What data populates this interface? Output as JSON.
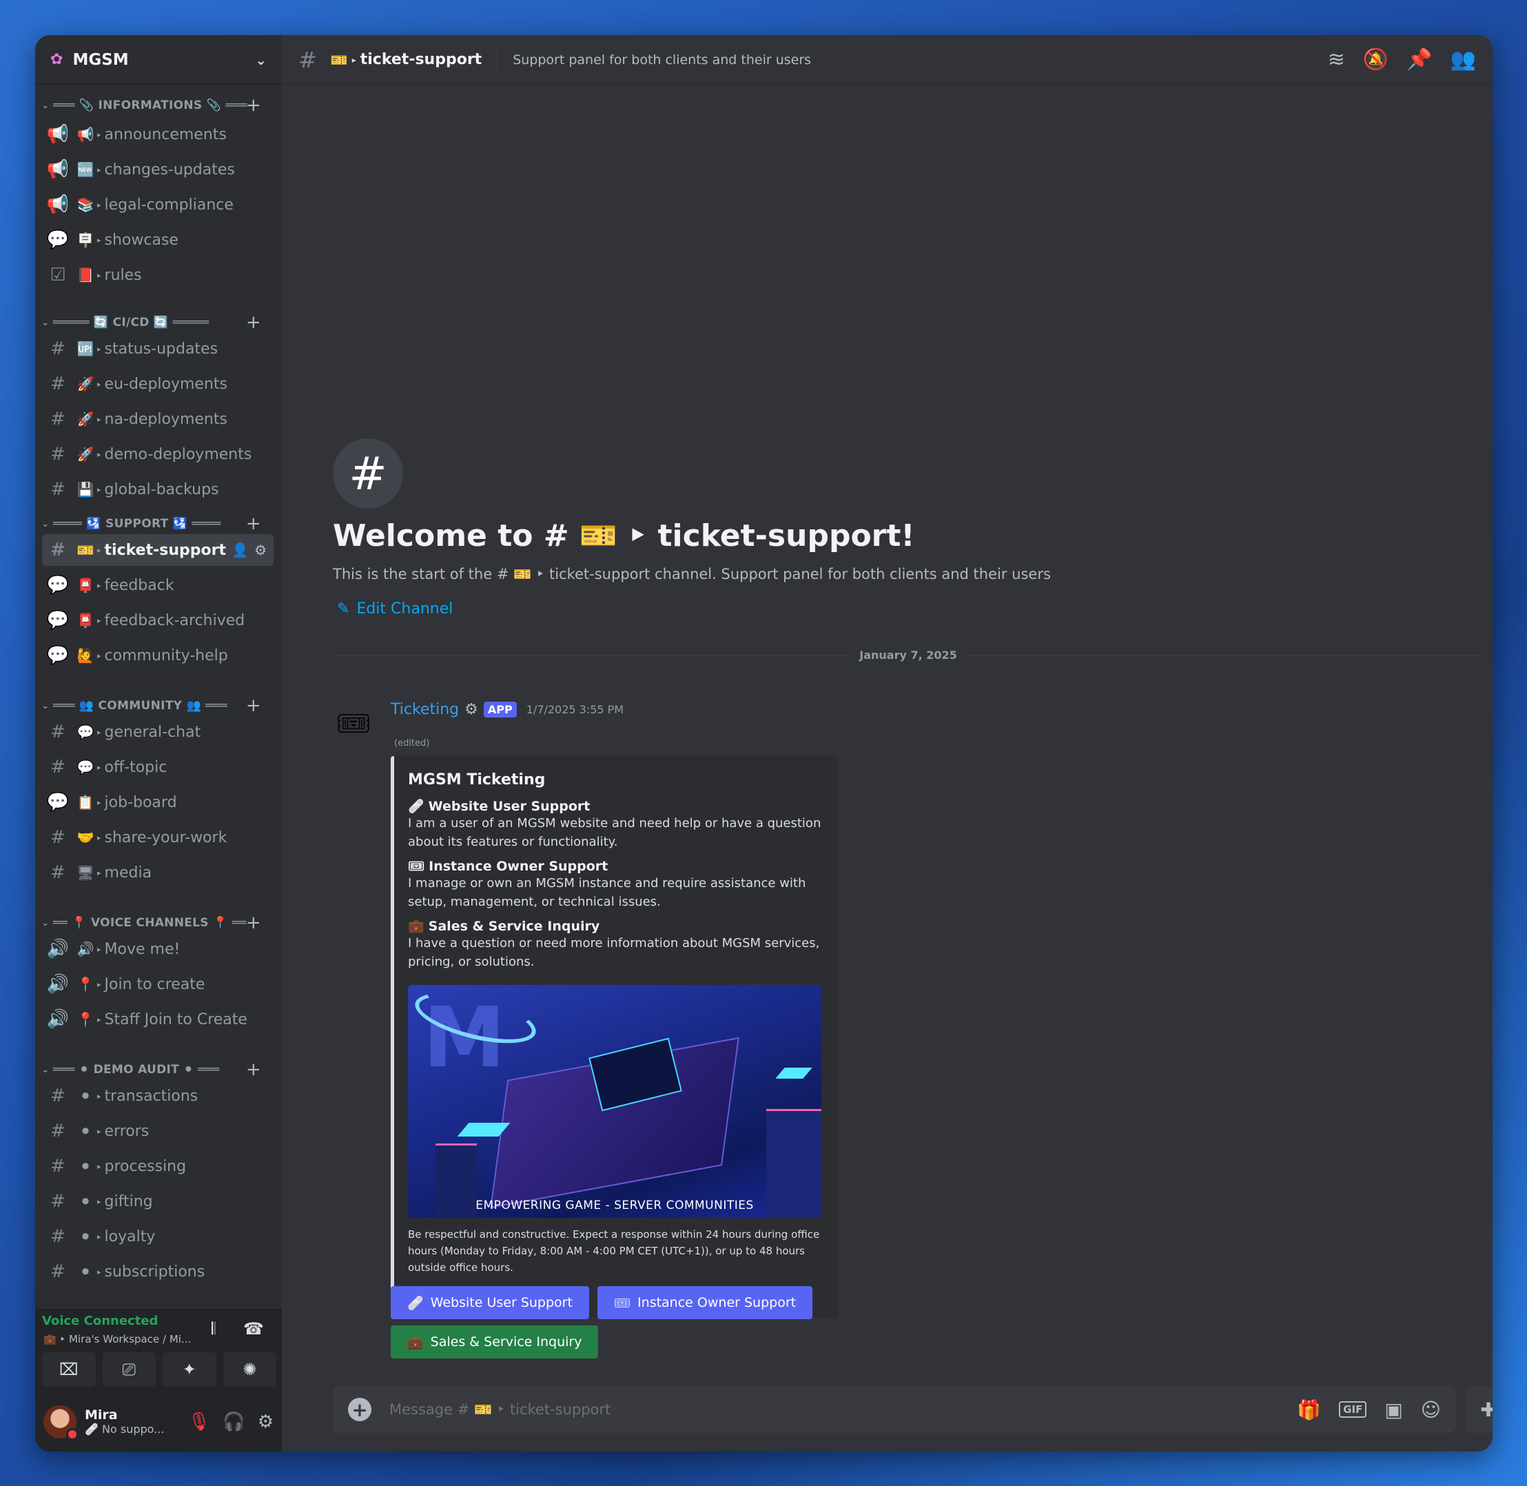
{
  "server": {
    "name": "MGSM"
  },
  "categories": {
    "informations": {
      "label": "═══ 📎 INFORMATIONS 📎 ═══"
    },
    "cicd": {
      "label": "═════ 🔄 CI/CD 🔄 ═════"
    },
    "support": {
      "label": "════ 🛂 SUPPORT 🛂 ════"
    },
    "community": {
      "label": "═══ 👥 COMMUNITY 👥 ═══"
    },
    "voice": {
      "label": "══ 📍 VOICE CHANNELS 📍 ══"
    },
    "demo_audit": {
      "label": "═══ ⚫ DEMO AUDIT ⚫ ═══"
    }
  },
  "channels": [
    {
      "type": "📢",
      "emoji": "📢",
      "label": "announcements"
    },
    {
      "type": "📢",
      "emoji": "🆕",
      "label": "changes-updates"
    },
    {
      "type": "📢",
      "emoji": "📚",
      "label": "legal-compliance"
    },
    {
      "type": "💬",
      "emoji": "🪧",
      "label": "showcase"
    },
    {
      "type": "☑",
      "emoji": "📕",
      "label": "rules"
    },
    {
      "type": "#",
      "emoji": "🆙",
      "label": "status-updates"
    },
    {
      "type": "#",
      "emoji": "🚀",
      "label": "eu-deployments"
    },
    {
      "type": "#",
      "emoji": "🚀",
      "label": "na-deployments"
    },
    {
      "type": "#",
      "emoji": "🚀",
      "label": "demo-deployments"
    },
    {
      "type": "#",
      "emoji": "💾",
      "label": "global-backups"
    },
    {
      "type": "#",
      "emoji": "🎫",
      "label": "ticket-support"
    },
    {
      "type": "💬",
      "emoji": "📮",
      "label": "feedback"
    },
    {
      "type": "💬",
      "emoji": "📮",
      "label": "feedback-archived"
    },
    {
      "type": "💬",
      "emoji": "🙋",
      "label": "community-help"
    },
    {
      "type": "#",
      "emoji": "💬",
      "label": "general-chat"
    },
    {
      "type": "#",
      "emoji": "💬",
      "label": "off-topic"
    },
    {
      "type": "💬",
      "emoji": "📋",
      "label": "job-board"
    },
    {
      "type": "#",
      "emoji": "🤝",
      "label": "share-your-work"
    },
    {
      "type": "#",
      "emoji": "🖥",
      "label": "media"
    },
    {
      "type": "🔊",
      "emoji": "🔊",
      "label": "Move me!"
    },
    {
      "type": "🔊",
      "emoji": "📍",
      "label": "Join to create"
    },
    {
      "type": "🔊",
      "emoji": "📍",
      "label": "Staff Join to Create"
    },
    {
      "type": "#",
      "emoji": "⚫",
      "label": "transactions"
    },
    {
      "type": "#",
      "emoji": "⚫",
      "label": "errors"
    },
    {
      "type": "#",
      "emoji": "⚫",
      "label": "processing"
    },
    {
      "type": "#",
      "emoji": "⚫",
      "label": "gifting"
    },
    {
      "type": "#",
      "emoji": "⚫",
      "label": "loyalty"
    },
    {
      "type": "#",
      "emoji": "⚫",
      "label": "subscriptions"
    }
  ],
  "voice": {
    "status": "Voice Connected",
    "location": "💼 ‣ Mira's Workspace / Mi..."
  },
  "user": {
    "name": "Mira",
    "status": "🩹 No suppo..."
  },
  "topbar": {
    "emoji": "🎫",
    "channel": "ticket-support",
    "topic": "Support panel for both clients and their users"
  },
  "welcome": {
    "title": "Welcome to # 🎫 ‣ ticket-support!",
    "subtitle": "This is the start of the # 🎫 ‣ ticket-support channel. Support panel for both clients and their users",
    "edit_label": "Edit Channel"
  },
  "date_divider": "January 7, 2025",
  "message": {
    "author": "Ticketing",
    "badge": "APP",
    "time": "1/7/2025 3:55 PM",
    "edited": "(edited)",
    "embed": {
      "title": "MGSM Ticketing",
      "fields": [
        {
          "icon": "🩹",
          "name": "Website User Support",
          "value": "I am a user of an MGSM website and need help or have a question about its features or functionality."
        },
        {
          "icon": "🎟",
          "name": "Instance Owner Support",
          "value": "I manage or own an MGSM instance and require assistance with setup, management, or technical issues."
        },
        {
          "icon": "💼",
          "name": "Sales & Service Inquiry",
          "value": "I have a question or need more information about MGSM services, pricing, or solutions."
        }
      ],
      "image_caption": "EMPOWERING GAME - SERVER COMMUNITIES",
      "footer": "Be respectful and constructive. Expect a response within 24 hours during office hours (Monday to Friday, 8:00 AM - 4:00 PM CET (UTC+1)), or up to 48 hours outside office hours."
    },
    "buttons": [
      {
        "icon": "🩹",
        "label": "Website User Support"
      },
      {
        "icon": "🎟",
        "label": "Instance Owner Support"
      },
      {
        "icon": "💼",
        "label": "Sales & Service Inquiry"
      }
    ]
  },
  "composer": {
    "placeholder": "Message # 🎫 ‣ ticket-support",
    "gif_label": "GIF"
  },
  "colors": {
    "accent": "#5865f2",
    "success": "#248046",
    "link": "#00a8fc",
    "voice_connected": "#23a55a",
    "dnd": "#f23f43"
  }
}
